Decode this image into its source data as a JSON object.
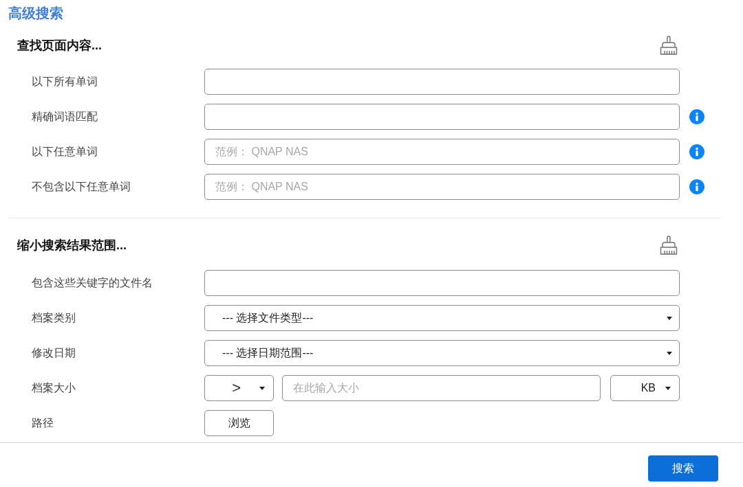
{
  "title": "高级搜索",
  "sections": [
    {
      "heading": "查找页面内容...",
      "fields": [
        {
          "label": "以下所有单词",
          "kind": "text",
          "info": false
        },
        {
          "label": "精确词语匹配",
          "kind": "text",
          "info": true
        },
        {
          "label": "以下任意单词",
          "kind": "text",
          "placeholder": "范例： QNAP NAS",
          "info": true
        },
        {
          "label": "不包含以下任意单词",
          "kind": "text",
          "placeholder": "范例： QNAP NAS",
          "info": true
        }
      ]
    },
    {
      "heading": "缩小搜索结果范围...",
      "fields": [
        {
          "label": "包含这些关键字的文件名",
          "kind": "text"
        },
        {
          "label": "档案类别",
          "kind": "select",
          "value": "--- 选择文件类型---"
        },
        {
          "label": "修改日期",
          "kind": "select",
          "value": "--- 选择日期范围---"
        },
        {
          "label": "档案大小",
          "kind": "size",
          "operator": ">",
          "placeholder": "在此输入大小",
          "unit": "KB"
        },
        {
          "label": "路径",
          "kind": "button",
          "button": "浏览"
        }
      ]
    }
  ],
  "search_button": "搜索"
}
